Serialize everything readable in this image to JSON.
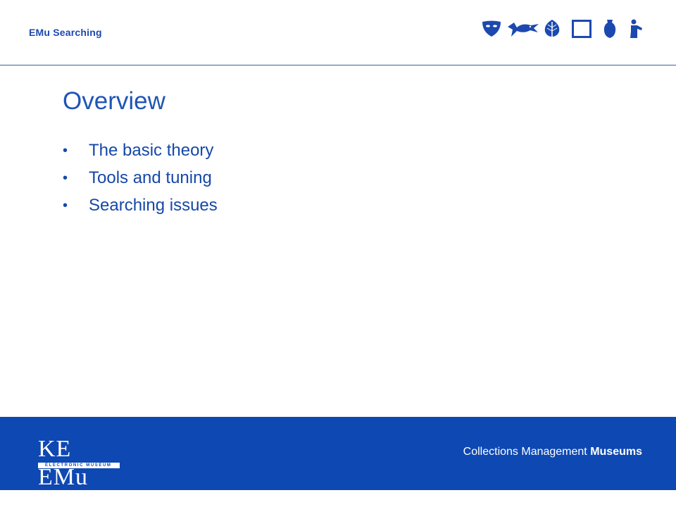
{
  "header": {
    "title": "EMu Searching",
    "icons": [
      "mask-icon",
      "bird-icon",
      "leaf-icon",
      "frame-icon",
      "vase-icon",
      "statue-icon"
    ]
  },
  "slide": {
    "title": "Overview",
    "bullet_glyph": "•",
    "bullets": [
      "The basic theory",
      "Tools and tuning",
      "Searching issues"
    ]
  },
  "footer": {
    "logo_text": "KE EMu",
    "logo_subtext": "ELECTRONIC MUSEUM",
    "tagline_regular": "Collections Management",
    "tagline_bold": "Museums"
  },
  "colors": {
    "accent": "#1c49b0",
    "footer_bg": "#0e48b2",
    "text": "#1548a8"
  }
}
